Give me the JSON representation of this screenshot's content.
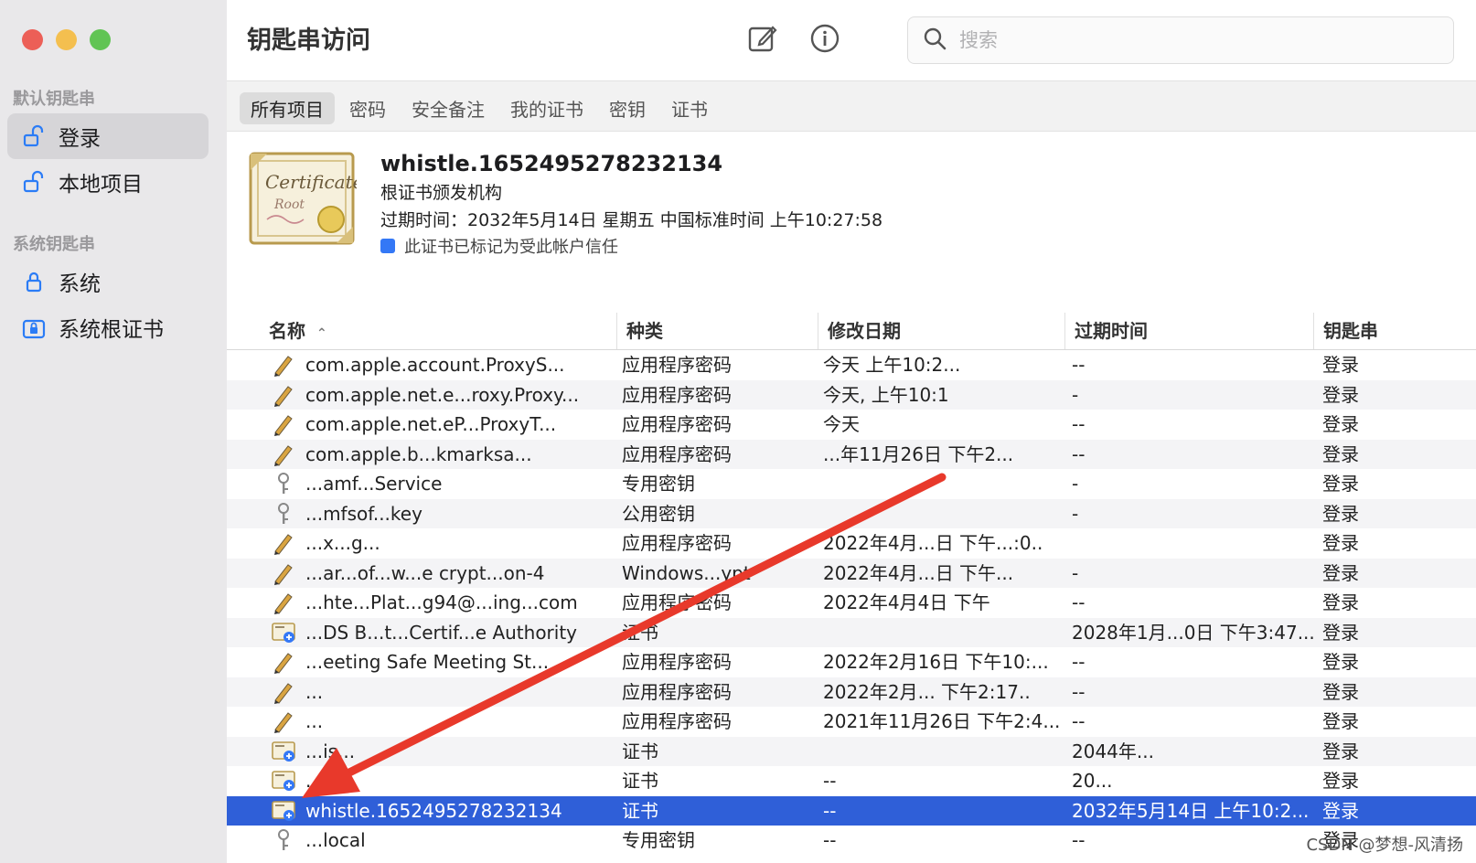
{
  "window": {
    "title": "钥匙串访问"
  },
  "sidebar": {
    "sections": [
      {
        "title": "默认钥匙串",
        "items": [
          {
            "label": "登录",
            "icon": "unlocked-padlock-icon",
            "selected": true
          },
          {
            "label": "本地项目",
            "icon": "unlocked-padlock-icon",
            "selected": false
          }
        ]
      },
      {
        "title": "系统钥匙串",
        "items": [
          {
            "label": "系统",
            "icon": "padlock-icon",
            "selected": false
          },
          {
            "label": "系统根证书",
            "icon": "padlock-cabinet-icon",
            "selected": false
          }
        ]
      }
    ]
  },
  "toolbar": {
    "search_placeholder": "搜索"
  },
  "tabs": [
    {
      "label": "所有项目",
      "selected": true
    },
    {
      "label": "密码",
      "selected": false
    },
    {
      "label": "安全备注",
      "selected": false
    },
    {
      "label": "我的证书",
      "selected": false
    },
    {
      "label": "密钥",
      "selected": false
    },
    {
      "label": "证书",
      "selected": false
    }
  ],
  "info": {
    "name": "whistle.1652495278232134",
    "issuer": "根证书颁发机构",
    "expires": "过期时间：2032年5月14日 星期五 中国标准时间 上午10:27:58",
    "trust": "此证书已标记为受此帐户信任"
  },
  "table": {
    "columns": [
      "名称",
      "种类",
      "修改日期",
      "过期时间",
      "钥匙串"
    ],
    "rows": [
      {
        "icon": "pencil-icon",
        "name": "com.apple.account.ProxyS...",
        "kind": "应用程序密码",
        "modified": "今天 上午10:2...",
        "expires": "--",
        "keychain": "登录"
      },
      {
        "icon": "pencil-icon",
        "name": "com.apple.net.e...roxy.Proxy...",
        "kind": "应用程序密码",
        "modified": "今天, 上午10:1",
        "expires": "-",
        "keychain": "登录"
      },
      {
        "icon": "pencil-icon",
        "name": "com.apple.net.eP...ProxyT...",
        "kind": "应用程序密码",
        "modified": "今天",
        "expires": "--",
        "keychain": "登录"
      },
      {
        "icon": "pencil-icon",
        "name": "com.apple.b...kmarksa...",
        "kind": "应用程序密码",
        "modified": "...年11月26日 下午2...",
        "expires": "--",
        "keychain": "登录"
      },
      {
        "icon": "key-icon",
        "name": "...amf...Service",
        "kind": "专用密钥",
        "modified": "",
        "expires": "-",
        "keychain": "登录"
      },
      {
        "icon": "key-icon",
        "name": "...mfsof...key",
        "kind": "公用密钥",
        "modified": "",
        "expires": "-",
        "keychain": "登录"
      },
      {
        "icon": "pencil-icon",
        "name": "...x...g...",
        "kind": "应用程序密码",
        "modified": "2022年4月...日 下午...:0..",
        "expires": "",
        "keychain": "登录"
      },
      {
        "icon": "pencil-icon",
        "name": "...ar...of...w...e crypt...on-4",
        "kind": "Windows...ypt",
        "modified": "2022年4月...日 下午...",
        "expires": "-",
        "keychain": "登录"
      },
      {
        "icon": "pencil-icon",
        "name": "...hte...Plat...g94@...ing...com",
        "kind": "应用程序密码",
        "modified": "2022年4月4日 下午",
        "expires": "--",
        "keychain": "登录"
      },
      {
        "icon": "certificate-icon",
        "name": "...DS B...t...Certif...e Authority",
        "kind": "证书",
        "modified": "",
        "expires": "2028年1月...0日 下午3:47...",
        "keychain": "登录"
      },
      {
        "icon": "pencil-icon",
        "name": "...eeting Safe Meeting St...",
        "kind": "应用程序密码",
        "modified": "2022年2月16日 下午10:...",
        "expires": "--",
        "keychain": "登录"
      },
      {
        "icon": "pencil-icon",
        "name": "...",
        "kind": "应用程序密码",
        "modified": "2022年2月... 下午2:17..",
        "expires": "--",
        "keychain": "登录"
      },
      {
        "icon": "pencil-icon",
        "name": "...",
        "kind": "应用程序密码",
        "modified": "2021年11月26日 下午2:4...",
        "expires": "--",
        "keychain": "登录"
      },
      {
        "icon": "certificate-icon",
        "name": "...is...",
        "kind": "证书",
        "modified": "",
        "expires": "2044年...",
        "keychain": "登录"
      },
      {
        "icon": "certificate-icon",
        "name": "...",
        "kind": "证书",
        "modified": "--",
        "expires": "20...",
        "keychain": "登录"
      },
      {
        "icon": "certificate-icon",
        "name": "whistle.1652495278232134",
        "kind": "证书",
        "modified": "--",
        "expires": "2032年5月14日 上午10:2...",
        "keychain": "登录",
        "selected": true
      },
      {
        "icon": "key-icon",
        "name": "...local",
        "kind": "专用密钥",
        "modified": "--",
        "expires": "--",
        "keychain": "登录"
      }
    ]
  },
  "watermark": "CSDN @梦想-风清扬",
  "colors": {
    "selection": "#2f5fd8",
    "arrow": "#e8392b"
  }
}
